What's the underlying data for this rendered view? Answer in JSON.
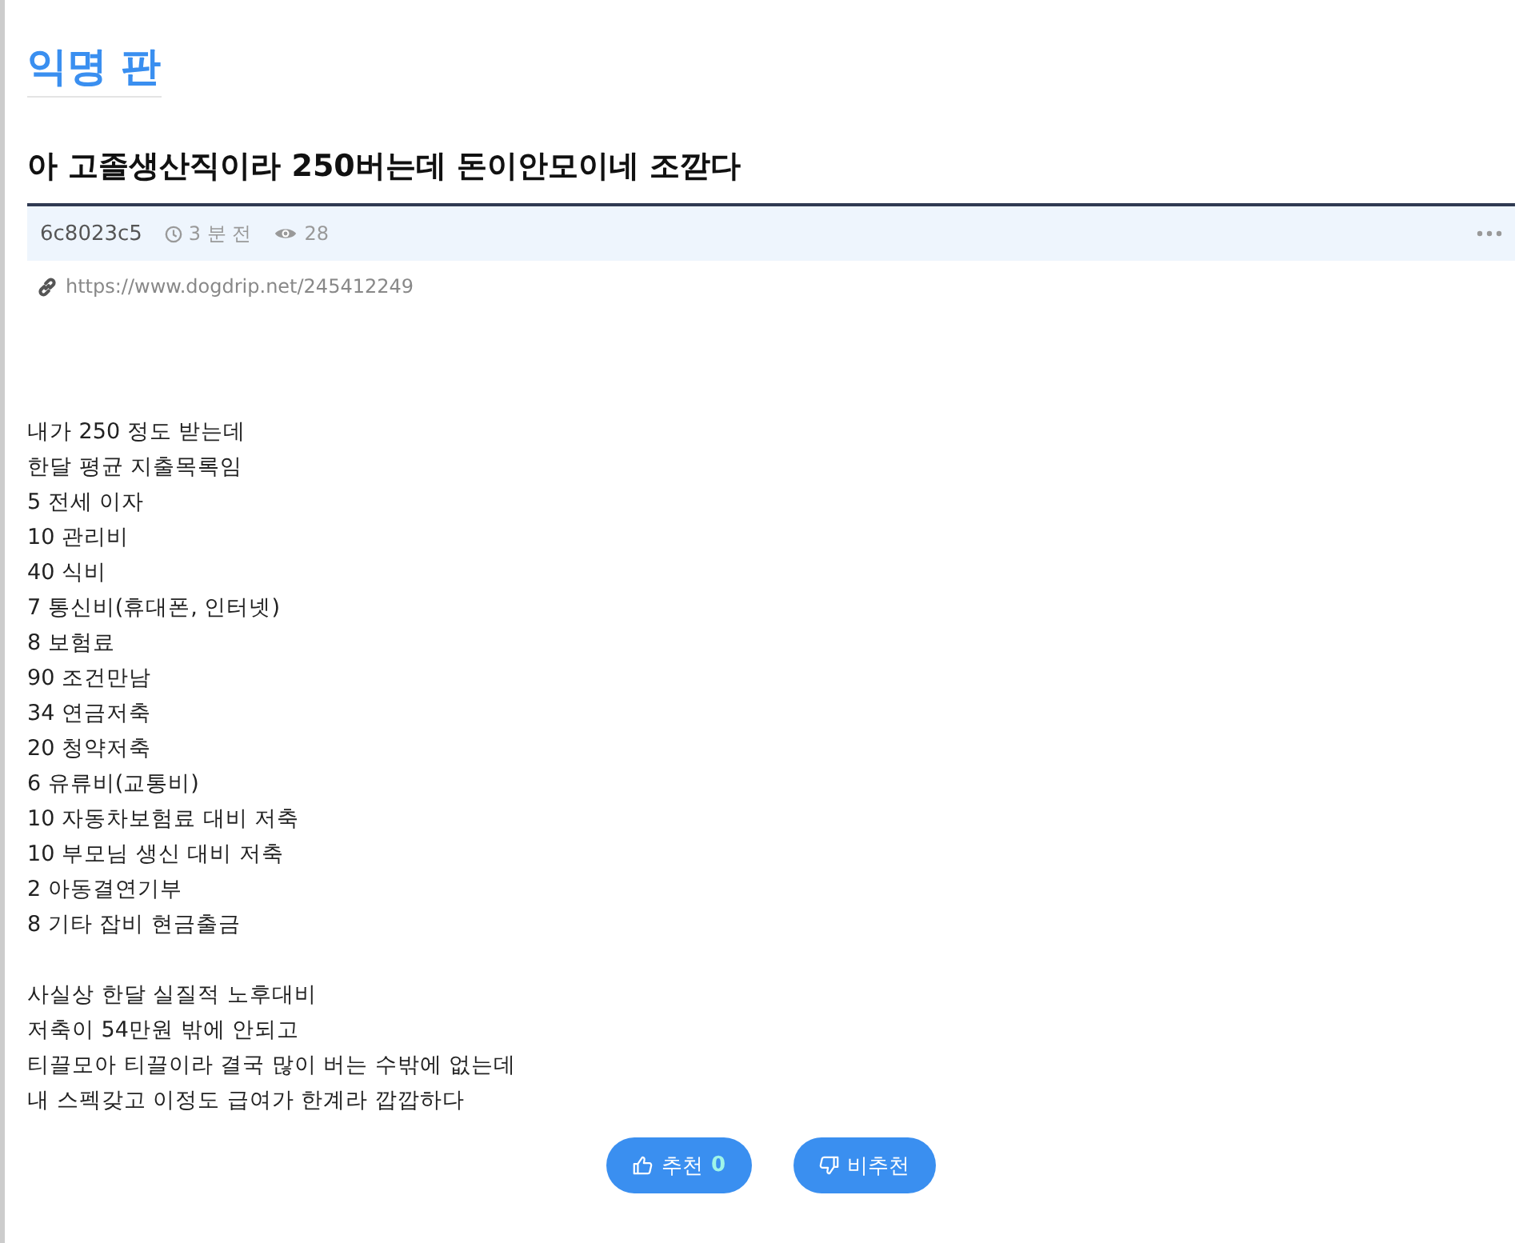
{
  "board": {
    "title": "익명 판"
  },
  "post": {
    "title": "아 고졸생산직이라 250버는데 돈이안모이네 조깓다",
    "author": "6c8023c5",
    "time": "3 분 전",
    "views": "28",
    "url": "https://www.dogdrip.net/245412249",
    "paragraphs": [
      [
        "내가 250 정도 받는데",
        "한달 평균 지출목록임",
        "5 전세 이자",
        "10 관리비",
        "40 식비",
        "7 통신비(휴대폰, 인터넷)",
        "8 보험료",
        "90 조건만남",
        "34 연금저축",
        "20 청약저축",
        "6 유류비(교통비)",
        "10 자동차보험료 대비 저축",
        "10 부모님 생신 대비 저축",
        "2 아동결연기부",
        "8 기타 잡비 현금출금"
      ],
      [
        "사실상 한달 실질적 노후대비",
        "저축이 54만원 밖에 안되고",
        "티끌모아 티끌이라 결국 많이 버는 수밖에 없는데",
        "내 스펙갖고 이정도 급여가 한계라 깝깝하다"
      ]
    ]
  },
  "votes": {
    "up_label": "추천",
    "up_count": "0",
    "down_label": "비추천"
  }
}
